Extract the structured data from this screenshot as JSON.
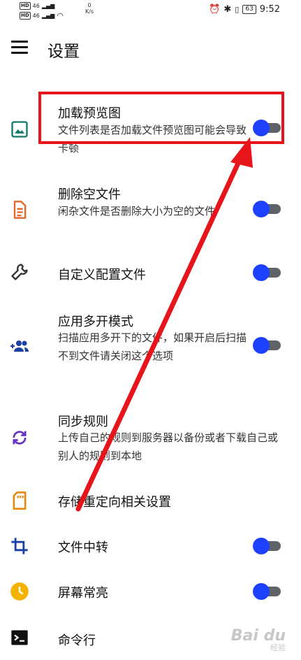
{
  "status_bar": {
    "net_line1": "46",
    "net_line2": "46",
    "hd_label": "HD",
    "speed_value": "0",
    "speed_unit": "K/s",
    "battery": "63",
    "time": "9:52"
  },
  "app_bar": {
    "title": "设置"
  },
  "settings": [
    {
      "id": "load-preview",
      "title": "加载预览图",
      "subtitle": "文件列表是否加载文件预览图可能会导致卡顿",
      "icon": "image-icon",
      "toggle": true
    },
    {
      "id": "delete-empty",
      "title": "删除空文件",
      "subtitle": "闲杂文件是否删除大小为空的文件",
      "icon": "document-icon",
      "toggle": true
    },
    {
      "id": "custom-config",
      "title": "自定义配置文件",
      "subtitle": "",
      "icon": "wrench-icon",
      "toggle": true
    },
    {
      "id": "multi-open",
      "title": "应用多开模式",
      "subtitle": "扫描应用多开下的文件，如果开启后扫描不到文件请关闭这个选项",
      "icon": "add-group-icon",
      "toggle": true
    },
    {
      "id": "sync-rules",
      "title": "同步规则",
      "subtitle": "上传自己的规则到服务器以备份或者下载自己或别人的规则到本地",
      "icon": "sync-icon",
      "toggle": false
    },
    {
      "id": "storage-redirect",
      "title": "存储重定向相关设置",
      "subtitle": "",
      "icon": "sd-card-icon",
      "toggle": false
    },
    {
      "id": "file-transfer",
      "title": "文件中转",
      "subtitle": "",
      "icon": "crop-icon",
      "toggle": true
    },
    {
      "id": "screen-on",
      "title": "屏幕常亮",
      "subtitle": "",
      "icon": "clock-icon",
      "toggle": true
    },
    {
      "id": "command-line",
      "title": "命令行",
      "subtitle": "",
      "icon": "terminal-icon",
      "toggle": false
    }
  ],
  "colors": {
    "accent": "#1e40ff",
    "annotation": "#e8141c"
  },
  "watermark": {
    "text": "Bai du",
    "sub": "经验"
  }
}
